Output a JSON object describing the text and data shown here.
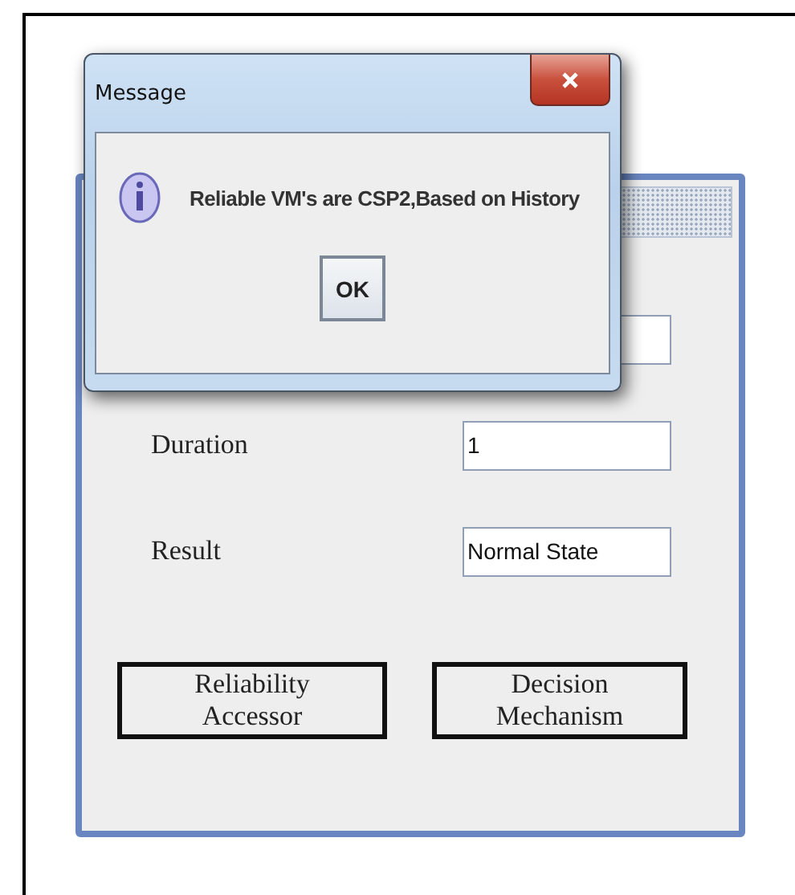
{
  "form": {
    "rows": [
      {
        "label": "Duration",
        "value": "1"
      },
      {
        "label": "Result",
        "value": "Normal State"
      }
    ],
    "buttons": [
      "Reliability Accessor",
      "Decision Mechanism"
    ]
  },
  "dialog": {
    "title": "Message",
    "message": "Reliable VM's are CSP2,Based on History",
    "button": "OK"
  }
}
